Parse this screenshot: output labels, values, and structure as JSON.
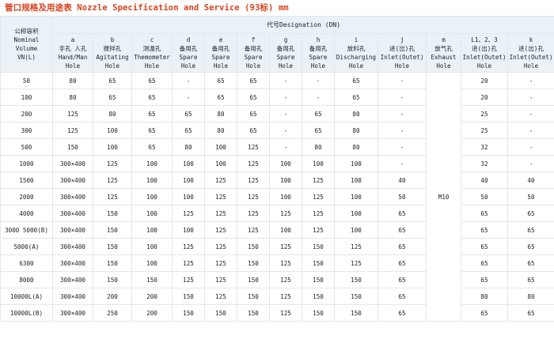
{
  "title": "管口规格及用途表 Nozzle Specification and Service  (93标)   mm",
  "corner_header": [
    "公称容积",
    "Nominal",
    "Volume",
    "VN(L)"
  ],
  "group_header": "代号Designation (DN)",
  "columns": [
    {
      "lines": [
        "a",
        "手孔 人孔",
        "Hand/Man",
        "Hole"
      ]
    },
    {
      "lines": [
        "b",
        "搅拌孔",
        "Agitating",
        "Hole"
      ]
    },
    {
      "lines": [
        "c",
        "测温孔",
        "Themometer",
        "Hole"
      ]
    },
    {
      "lines": [
        "d",
        "备用孔",
        "Spare",
        "Hole"
      ]
    },
    {
      "lines": [
        "e",
        "备用孔",
        "Spare",
        "Hole"
      ]
    },
    {
      "lines": [
        "f",
        "备用孔",
        "Spare",
        "Hole"
      ]
    },
    {
      "lines": [
        "g",
        "备用孔",
        "Spare",
        "Hole"
      ]
    },
    {
      "lines": [
        "h",
        "备用孔",
        "Spare",
        "Hole"
      ]
    },
    {
      "lines": [
        "i",
        "放料孔",
        "Discharging",
        "Hole"
      ]
    },
    {
      "lines": [
        "j",
        "进(出)孔",
        "Inlet(Outet)",
        "Hole"
      ]
    },
    {
      "lines": [
        "m",
        "放气孔",
        "Exhaust",
        "Hole"
      ]
    },
    {
      "lines": [
        "L1、2、3",
        "进(出)孔",
        "Inlet(Outet)",
        "Hole"
      ]
    },
    {
      "lines": [
        "k",
        "进(出)孔",
        "Inlet(Outet)",
        "Hole"
      ]
    }
  ],
  "m_value": "M10",
  "rows": [
    {
      "vn": "50",
      "cells": [
        "80",
        "65",
        "65",
        "-",
        "65",
        "65",
        "-",
        "-",
        "65",
        "-",
        "20",
        "-"
      ]
    },
    {
      "vn": "100",
      "cells": [
        "80",
        "65",
        "65",
        "-",
        "65",
        "65",
        "-",
        "-",
        "65",
        "-",
        "20",
        "-"
      ]
    },
    {
      "vn": "200",
      "cells": [
        "125",
        "80",
        "65",
        "65",
        "80",
        "65",
        "-",
        "65",
        "80",
        "-",
        "25",
        "-"
      ]
    },
    {
      "vn": "300",
      "cells": [
        "125",
        "100",
        "65",
        "65",
        "80",
        "65",
        "-",
        "65",
        "80",
        "-",
        "25",
        "-"
      ]
    },
    {
      "vn": "500",
      "cells": [
        "150",
        "100",
        "65",
        "80",
        "100",
        "125",
        "-",
        "80",
        "80",
        "-",
        "32",
        "-"
      ]
    },
    {
      "vn": "1000",
      "cells": [
        "300×400",
        "125",
        "100",
        "100",
        "100",
        "125",
        "100",
        "100",
        "100",
        "-",
        "32",
        "-"
      ]
    },
    {
      "vn": "1500",
      "cells": [
        "300×400",
        "125",
        "100",
        "100",
        "125",
        "125",
        "100",
        "125",
        "100",
        "40",
        "40",
        "40"
      ]
    },
    {
      "vn": "2000",
      "cells": [
        "300×400",
        "125",
        "100",
        "100",
        "125",
        "125",
        "100",
        "125",
        "100",
        "50",
        "50",
        "50"
      ]
    },
    {
      "vn": "4000",
      "cells": [
        "300×400",
        "150",
        "100",
        "125",
        "125",
        "125",
        "125",
        "125",
        "100",
        "65",
        "65",
        "65"
      ]
    },
    {
      "vn": "3000 5000(B)",
      "cells": [
        "300×400",
        "150",
        "100",
        "100",
        "125",
        "125",
        "100",
        "125",
        "100",
        "65",
        "65",
        "65"
      ]
    },
    {
      "vn": "5000(A)",
      "cells": [
        "300×400",
        "150",
        "100",
        "125",
        "125",
        "150",
        "125",
        "150",
        "125",
        "65",
        "65",
        "65"
      ]
    },
    {
      "vn": "6300",
      "cells": [
        "300×400",
        "150",
        "100",
        "125",
        "125",
        "150",
        "125",
        "150",
        "125",
        "65",
        "65",
        "65"
      ]
    },
    {
      "vn": "8000",
      "cells": [
        "300×400",
        "150",
        "150",
        "125",
        "125",
        "150",
        "125",
        "150",
        "150",
        "65",
        "65",
        "65"
      ]
    },
    {
      "vn": "10000L(A)",
      "cells": [
        "300×400",
        "200",
        "200",
        "150",
        "125",
        "150",
        "125",
        "150",
        "150",
        "65",
        "80",
        "80"
      ]
    },
    {
      "vn": "10000L(B)",
      "cells": [
        "300×400",
        "250",
        "200",
        "150",
        "150",
        "150",
        "125",
        "150",
        "150",
        "65",
        "65",
        "65"
      ]
    }
  ]
}
